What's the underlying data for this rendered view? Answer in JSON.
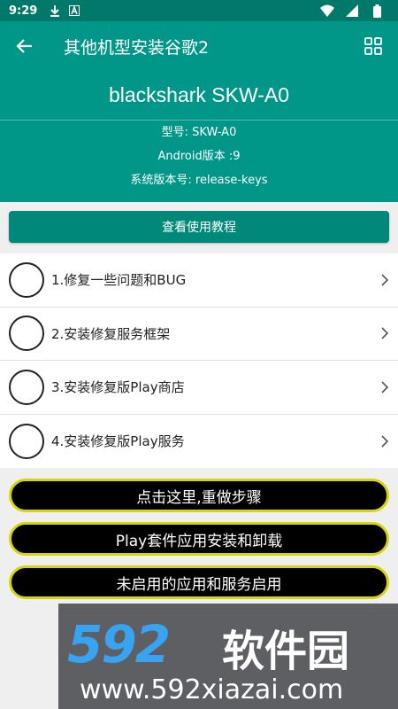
{
  "status_bar": {
    "time": "9:29"
  },
  "app_bar": {
    "title": "其他机型安装谷歌2"
  },
  "device": {
    "name": "blackshark SKW-A0",
    "model_line": "型号: SKW-A0",
    "android_line": "Android版本 :9",
    "system_line": "系统版本号: release-keys"
  },
  "tutorial_button": "查看使用教程",
  "steps": [
    {
      "label": "1.修复一些问题和BUG"
    },
    {
      "label": "2.安装修复服务框架"
    },
    {
      "label": "3.安装修复版Play商店"
    },
    {
      "label": "4.安装修复版Play服务"
    }
  ],
  "actions": {
    "redo": "点击这里,重做步骤",
    "play_suite": "Play套件应用安装和卸载",
    "enable_apps": "未启用的应用和服务启用"
  },
  "watermark": {
    "logo_number": "592",
    "logo_text": "软件园",
    "url": "www.592xiazai.com"
  },
  "colors": {
    "primary": "#009688",
    "primary_dark": "#00796b",
    "pill_border": "#d6d600",
    "watermark_blue": "#38a3f1"
  }
}
